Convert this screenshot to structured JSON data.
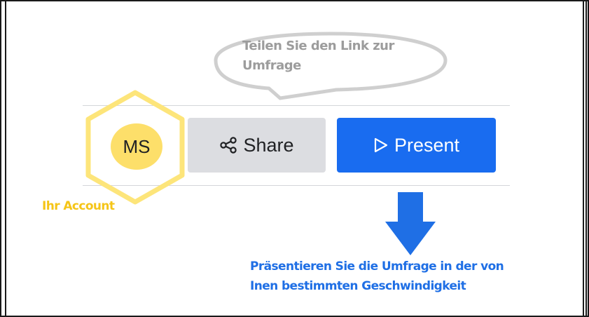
{
  "callouts": {
    "share_hint": "Teilen Sie den Link zur Umfrage",
    "account_hint": "Ihr Account",
    "present_hint_line1": "Präsentieren Sie die Umfrage in der von",
    "present_hint_line2": "Inen bestimmten Geschwindigkeit"
  },
  "toolbar": {
    "avatar_initials": "MS",
    "share_label": "Share",
    "share_icon": "share-icon",
    "present_label": "Present",
    "present_icon": "play-icon"
  },
  "colors": {
    "avatar_bg": "#fddf6a",
    "hexagon_highlight": "#fde57a",
    "account_text": "#f5c518",
    "share_button_bg": "#dcdde1",
    "present_button_bg": "#196cf0",
    "present_hint_text": "#1f6fe5",
    "arrow": "#1f6fe5",
    "bubble_outline": "#cfcfcf",
    "bubble_text": "#9c9c9c"
  }
}
